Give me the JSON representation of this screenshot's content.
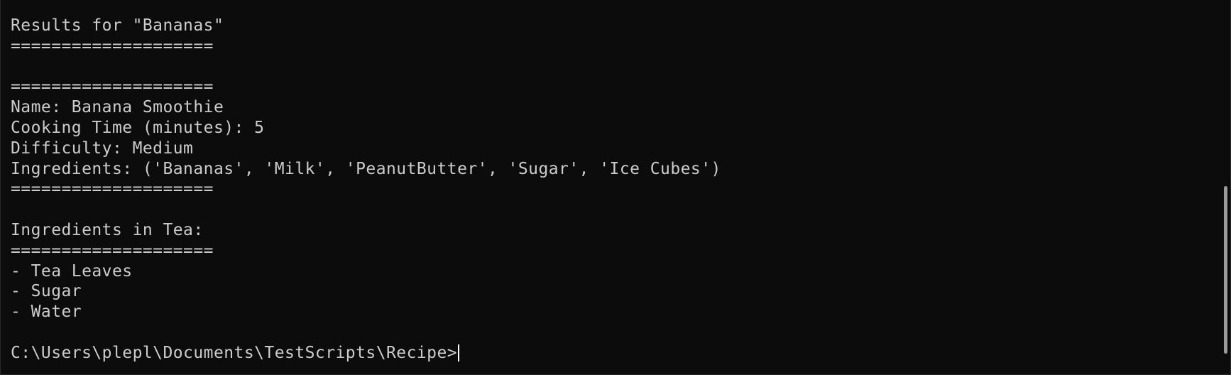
{
  "terminal": {
    "lines": {
      "l1": "Results for \"Bananas\"",
      "l2": "====================",
      "l3": "",
      "l4": "====================",
      "l5": "Name: Banana Smoothie",
      "l6": "Cooking Time (minutes): 5",
      "l7": "Difficulty: Medium",
      "l8": "Ingredients: ('Bananas', 'Milk', 'PeanutButter', 'Sugar', 'Ice Cubes')",
      "l9": "====================",
      "l10": "",
      "l11": "Ingredients in Tea:",
      "l12": "====================",
      "l13": "- Tea Leaves",
      "l14": "- Sugar",
      "l15": "- Water",
      "l16": ""
    },
    "prompt": "C:\\Users\\plepl\\Documents\\TestScripts\\Recipe>"
  },
  "colors": {
    "background": "#0c0c0c",
    "text": "#cccccc",
    "cursor": "#ffffff",
    "scrollbar_thumb": "#9a9a9a"
  }
}
